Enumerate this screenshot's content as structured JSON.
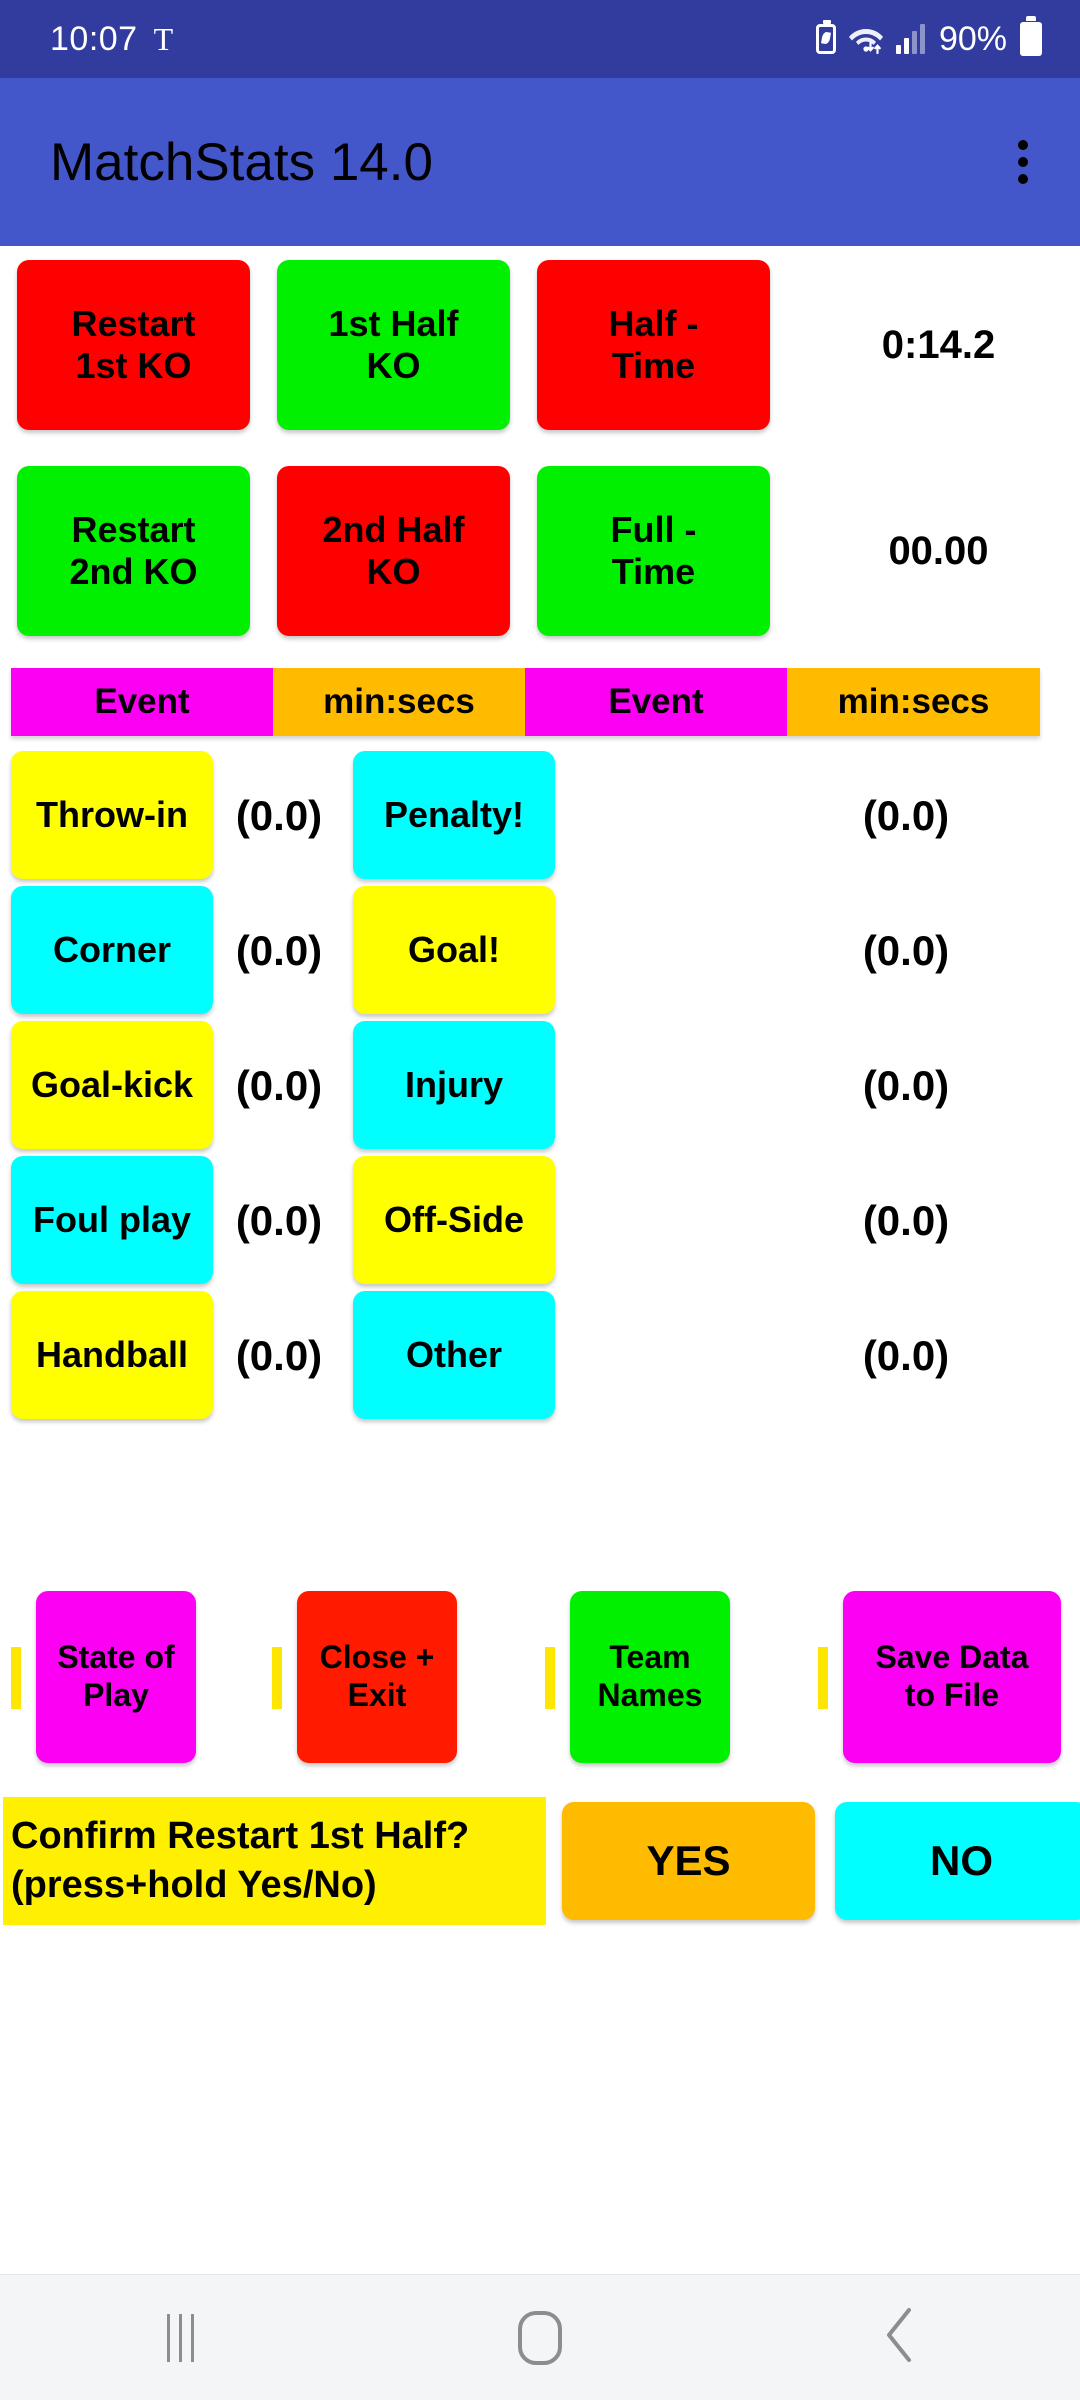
{
  "status_bar": {
    "clock": "10:07",
    "t_icon_label": "T",
    "battery_percent": "90%",
    "icons": [
      "battery-saver-icon",
      "wifi-icon",
      "signal-icon",
      "battery-icon"
    ]
  },
  "app_bar": {
    "title": "MatchStats 14.0",
    "overflow_icon": "overflow-menu-icon"
  },
  "half_controls": {
    "row1": {
      "buttons": [
        {
          "label": "Restart\n1st KO",
          "line1": "Restart",
          "line2": "1st KO",
          "color": "#ff0000"
        },
        {
          "label": "1st Half\nKO",
          "line1": "1st Half",
          "line2": "KO",
          "color": "#00f000"
        },
        {
          "label": "Half -\nTime",
          "line1": "Half -",
          "line2": "Time",
          "color": "#ff0000"
        }
      ],
      "clock": "0:14.2"
    },
    "row2": {
      "buttons": [
        {
          "label": "Restart\n2nd KO",
          "line1": "Restart",
          "line2": "2nd KO",
          "color": "#00f000"
        },
        {
          "label": "2nd Half\nKO",
          "line1": "2nd Half",
          "line2": "KO",
          "color": "#ff0000"
        },
        {
          "label": "Full -\nTime",
          "line1": "Full -",
          "line2": "Time",
          "color": "#00f000"
        }
      ],
      "clock": "00.00"
    }
  },
  "table_header": {
    "event_label_1": "Event",
    "time_label_1": "min:secs",
    "event_label_2": "Event",
    "time_label_2": "min:secs",
    "event_color": "#fb00f3",
    "time_color": "#ffbb00"
  },
  "event_grid": {
    "rows": [
      {
        "left": {
          "label": "Throw-in",
          "value": "(0.0)",
          "color": "#ffff00"
        },
        "right": {
          "label": "Penalty!",
          "value": "(0.0)",
          "color": "#00ffff"
        }
      },
      {
        "left": {
          "label": "Corner",
          "value": "(0.0)",
          "color": "#00ffff"
        },
        "right": {
          "label": "Goal!",
          "value": "(0.0)",
          "color": "#ffff00"
        }
      },
      {
        "left": {
          "label": "Goal-kick",
          "value": "(0.0)",
          "color": "#ffff00"
        },
        "right": {
          "label": "Injury",
          "value": "(0.0)",
          "color": "#00ffff"
        }
      },
      {
        "left": {
          "label": "Foul play",
          "value": "(0.0)",
          "color": "#00ffff"
        },
        "right": {
          "label": "Off-Side",
          "value": "(0.0)",
          "color": "#ffff00"
        }
      },
      {
        "left": {
          "label": "Handball",
          "value": "(0.0)",
          "color": "#ffff00"
        },
        "right": {
          "label": "Other",
          "value": "(0.0)",
          "color": "#00ffff"
        }
      }
    ]
  },
  "action_row": {
    "strip_color": "#ffe600",
    "buttons": [
      {
        "line1": "State of",
        "line2": "Play",
        "color": "#fb00f3"
      },
      {
        "line1": "Close +",
        "line2": "Exit",
        "color": "#ff1a00"
      },
      {
        "line1": "Team",
        "line2": "Names",
        "color": "#00f000"
      },
      {
        "line1": "Save Data",
        "line2": "to File",
        "color": "#fb00f3"
      }
    ]
  },
  "confirm_row": {
    "message_line1": "Confirm Restart 1st Half?",
    "message_line2": "(press+hold  Yes/No)",
    "message_color": "#ffef00",
    "yes_label": "YES",
    "yes_color": "#ffbb00",
    "no_label": "NO",
    "no_color": "#00ffff"
  },
  "nav_bar": {
    "recents_icon": "recents-icon",
    "home_icon": "home-icon",
    "back_icon": "back-icon"
  }
}
